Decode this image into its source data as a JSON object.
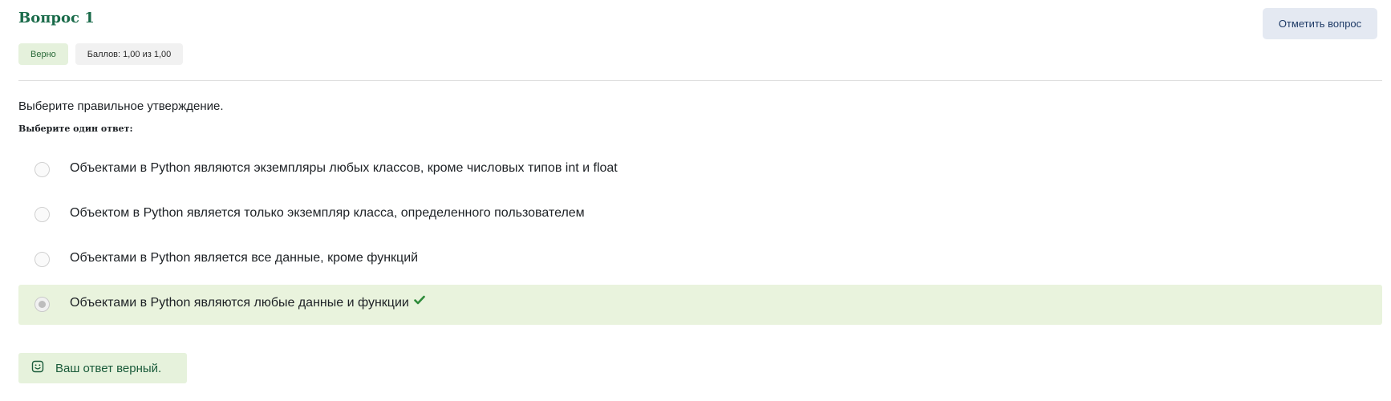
{
  "question": {
    "title": "Вопрос 1",
    "status_badge": "Верно",
    "grade_badge": "Баллов: 1,00 из 1,00",
    "flag_button": "Отметить вопрос",
    "text": "Выберите правильное утверждение.",
    "prompt": "Выберите один ответ:"
  },
  "answers": [
    {
      "label": "Объектами в Python являются экземпляры любых классов, кроме числовых типов int и float",
      "selected": false,
      "correct": false
    },
    {
      "label": "Объектом в Python является только экземпляр класса, определенного пользователем",
      "selected": false,
      "correct": false
    },
    {
      "label": "Объектами в Python является все данные, кроме функций",
      "selected": false,
      "correct": false
    },
    {
      "label": "Объектами в Python являются любые данные и функции",
      "selected": true,
      "correct": true
    }
  ],
  "feedback": {
    "text": "Ваш ответ верный.",
    "icon": "smile-icon"
  },
  "colors": {
    "title": "#1a6b4a",
    "correct_bg": "#e9f3dd",
    "flag_button_bg": "#e4e9f2",
    "check": "#2e8b3a"
  }
}
